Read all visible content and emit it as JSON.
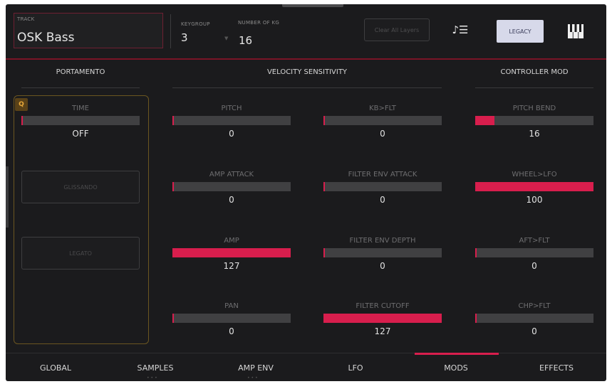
{
  "header": {
    "track_label": "TRACK",
    "track_name": "OSK Bass",
    "keygroup_label": "KEYGROUP",
    "keygroup_value": "3",
    "numkg_label": "NUMBER OF KG",
    "numkg_value": "16",
    "clear_label": "Clear All Layers",
    "legacy_label": "LEGACY",
    "icons": {
      "notes": "note-list-icon",
      "keyboard": "piano-keys-icon"
    }
  },
  "sections": {
    "portamento": "PORTAMENTO",
    "velocity": "VELOCITY SENSITIVITY",
    "controller": "CONTROLLER MOD"
  },
  "portamento": {
    "q_label": "Q",
    "time": {
      "label": "TIME",
      "value": "OFF",
      "fraction": 0
    },
    "button1": "Glissando",
    "button2": "Legato"
  },
  "velocity": {
    "col1": [
      {
        "label": "PITCH",
        "value": "0",
        "fraction": 0
      },
      {
        "label": "AMP ATTACK",
        "value": "0",
        "fraction": 0
      },
      {
        "label": "AMP",
        "value": "127",
        "fraction": 1
      },
      {
        "label": "PAN",
        "value": "0",
        "fraction": 0
      }
    ],
    "col2": [
      {
        "label": "KB>FLT",
        "value": "0",
        "fraction": 0
      },
      {
        "label": "FILTER ENV ATTACK",
        "value": "0",
        "fraction": 0
      },
      {
        "label": "FILTER ENV DEPTH",
        "value": "0",
        "fraction": 0
      },
      {
        "label": "FILTER CUTOFF",
        "value": "127",
        "fraction": 1
      }
    ]
  },
  "controller": [
    {
      "label": "PITCH BEND",
      "value": "16",
      "fraction": 0.16
    },
    {
      "label": "WHEEL>LFO",
      "value": "100",
      "fraction": 1
    },
    {
      "label": "AFT>FLT",
      "value": "0",
      "fraction": 0
    },
    {
      "label": "CHP>FLT",
      "value": "0",
      "fraction": 0
    }
  ],
  "tabs": [
    {
      "label": "GLOBAL",
      "active": false
    },
    {
      "label": "SAMPLES",
      "active": false
    },
    {
      "label": "AMP ENV",
      "active": false
    },
    {
      "label": "LFO",
      "active": false
    },
    {
      "label": "MODS",
      "active": true
    },
    {
      "label": "EFFECTS",
      "active": false
    }
  ],
  "colors": {
    "accent": "#d81e4d",
    "background": "#1b1b1d",
    "portamento_border": "#6b5620",
    "legacy_bg": "#d7d9ea"
  }
}
